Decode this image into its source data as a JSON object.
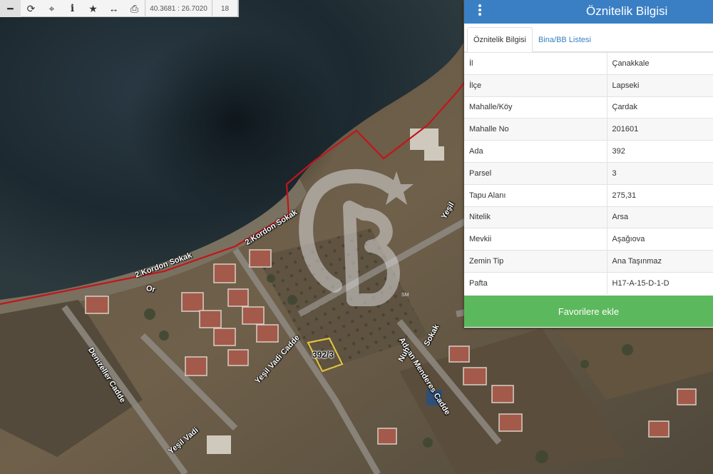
{
  "toolbar": {
    "buttons": [
      {
        "name": "zoom-out",
        "glyph": "━"
      },
      {
        "name": "refresh",
        "glyph": "⟳"
      },
      {
        "name": "crosshair",
        "glyph": "⌖"
      },
      {
        "name": "info",
        "glyph": "i"
      },
      {
        "name": "star",
        "glyph": "★"
      },
      {
        "name": "measure",
        "glyph": "↔"
      },
      {
        "name": "print",
        "glyph": "⎙"
      }
    ],
    "coords": "40.3681 : 26.7020",
    "zoom": "18"
  },
  "map": {
    "streets": [
      "2.Kordon Sokak",
      "2.Kordon Sokak",
      "Yeşil",
      "Denizeller Cadde",
      "Yeşil Vadi Cadde",
      "Yeşil Vadi",
      "Adnan Menderes Cadde",
      "Nuh",
      "Sokak",
      "Or"
    ],
    "parcel_label": "392/3",
    "colors": {
      "sea": "#1e2a33",
      "land": "#6b5b45",
      "boundary": "#c4141c",
      "parcel": "#e0c040"
    }
  },
  "watermark": {
    "text": "CB",
    "mark": "SM"
  },
  "panel": {
    "title": "Öznitelik Bilgisi",
    "tabs": [
      "Öznitelik Bilgisi",
      "Bina/BB Listesi"
    ],
    "rows": [
      {
        "key": "İl",
        "value": "Çanakkale"
      },
      {
        "key": "İlçe",
        "value": "Lapseki"
      },
      {
        "key": "Mahalle/Köy",
        "value": "Çardak"
      },
      {
        "key": "Mahalle No",
        "value": "201601"
      },
      {
        "key": "Ada",
        "value": "392"
      },
      {
        "key": "Parsel",
        "value": "3"
      },
      {
        "key": "Tapu Alanı",
        "value": "275,31"
      },
      {
        "key": "Nitelik",
        "value": "Arsa"
      },
      {
        "key": "Mevkii",
        "value": "Aşağıova"
      },
      {
        "key": "Zemin Tip",
        "value": "Ana Taşınmaz"
      },
      {
        "key": "Pafta",
        "value": "H17-A-15-D-1-D"
      }
    ],
    "favorite_label": "Favorilere ekle",
    "colors": {
      "header": "#3a7fc4",
      "button": "#5cb85c"
    }
  }
}
